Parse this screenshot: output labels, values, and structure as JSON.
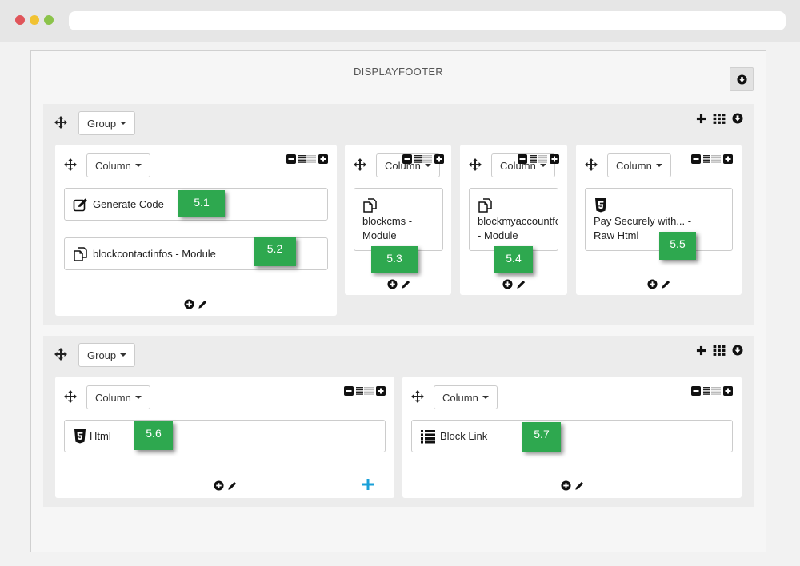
{
  "hook": {
    "title": "DISPLAYFOOTER"
  },
  "groups": [
    {
      "label": "Group",
      "columns": [
        {
          "label": "Column",
          "modules": [
            {
              "icon": "edit-icon",
              "label": "Generate Code",
              "badge": "5.1"
            },
            {
              "icon": "copy-icon",
              "label": "blockcontactinfos - Module",
              "badge": "5.2"
            }
          ]
        },
        {
          "label": "Column",
          "modules": [
            {
              "icon": "copy-icon",
              "label_line1": "blockcms -",
              "label_line2": "Module",
              "badge": "5.3"
            }
          ]
        },
        {
          "label": "Column",
          "modules": [
            {
              "icon": "copy-icon",
              "label_line1": "blockmyaccountfoo",
              "label_line2": "- Module",
              "badge": "5.4"
            }
          ]
        },
        {
          "label": "Column",
          "modules": [
            {
              "icon": "html5-icon",
              "label_line1": "Pay Securely with... -",
              "label_line2": "Raw Html",
              "badge": "5.5"
            }
          ]
        }
      ]
    },
    {
      "label": "Group",
      "columns": [
        {
          "label": "Column",
          "modules": [
            {
              "icon": "html5-icon",
              "label": "Html",
              "badge": "5.6"
            }
          ]
        },
        {
          "label": "Column",
          "modules": [
            {
              "icon": "list-icon",
              "label": "Block Link",
              "badge": "5.7"
            }
          ]
        }
      ]
    }
  ],
  "colors": {
    "badge": "#2ea84f",
    "add_row": "#1aa0d8",
    "panel": "#f6f6f6",
    "group": "#ececec"
  }
}
